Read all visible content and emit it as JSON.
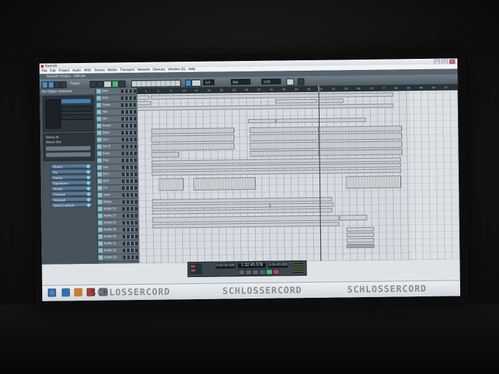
{
  "window": {
    "title": "Nuendo",
    "controls": [
      "–",
      "□",
      "×"
    ]
  },
  "menu": [
    "File",
    "Edit",
    "Project",
    "Audio",
    "MIDI",
    "Scores",
    "Media",
    "Transport",
    "Network",
    "Devices",
    "Window (5)",
    "Help"
  ],
  "project": {
    "title": "Nuendo Project - 3dB.npr"
  },
  "toolbar": {
    "mode": "Touch",
    "snap": "Bar",
    "quantize": "1/16",
    "grid_value": "1/3"
  },
  "inspector": {
    "status": "No Object Selected",
    "routing": [
      "Stereo In",
      "Stereo Out"
    ],
    "sections": [
      "Drums",
      "Eq",
      "Inserts",
      "Equalizers",
      "Sends",
      "Channel",
      "Notepad",
      "Quick Controls"
    ]
  },
  "tracks": [
    "Drm",
    "Kick",
    "Snare",
    "Hat",
    "OH",
    "Room",
    "Bass",
    "Gtr L",
    "Gtr R",
    "Keys",
    "Pad",
    "Vox",
    "BV1",
    "BV2",
    "FX",
    "Verb",
    "Delay",
    "Audio 16",
    "Audio 17",
    "Audio 18",
    "Audio 19",
    "Audio 20",
    "Audio 21",
    "Audio 22",
    "Audio 23"
  ],
  "ruler": [
    "1",
    "5",
    "9",
    "13",
    "17",
    "21",
    "25",
    "29",
    "33",
    "37",
    "41",
    "45",
    "49",
    "53",
    "57",
    "61",
    "65",
    "69",
    "73",
    "77",
    "81",
    "85",
    "89",
    "93",
    "97"
  ],
  "transport": {
    "position": "1:32:45.578",
    "left_locator": "0:00:00.000",
    "right_locator": "0:04:00.000"
  },
  "watermarks": [
    "SCHLOSSERCORD",
    "SCHLOSSERCORD",
    "SCHLOSSERCORD"
  ],
  "colors": {
    "cubase_bg": "#3b4954",
    "arrange_bg": "#d6dbe0",
    "accent": "#3f8fd6",
    "record": "#b94a4a",
    "play": "#3cbf66"
  }
}
